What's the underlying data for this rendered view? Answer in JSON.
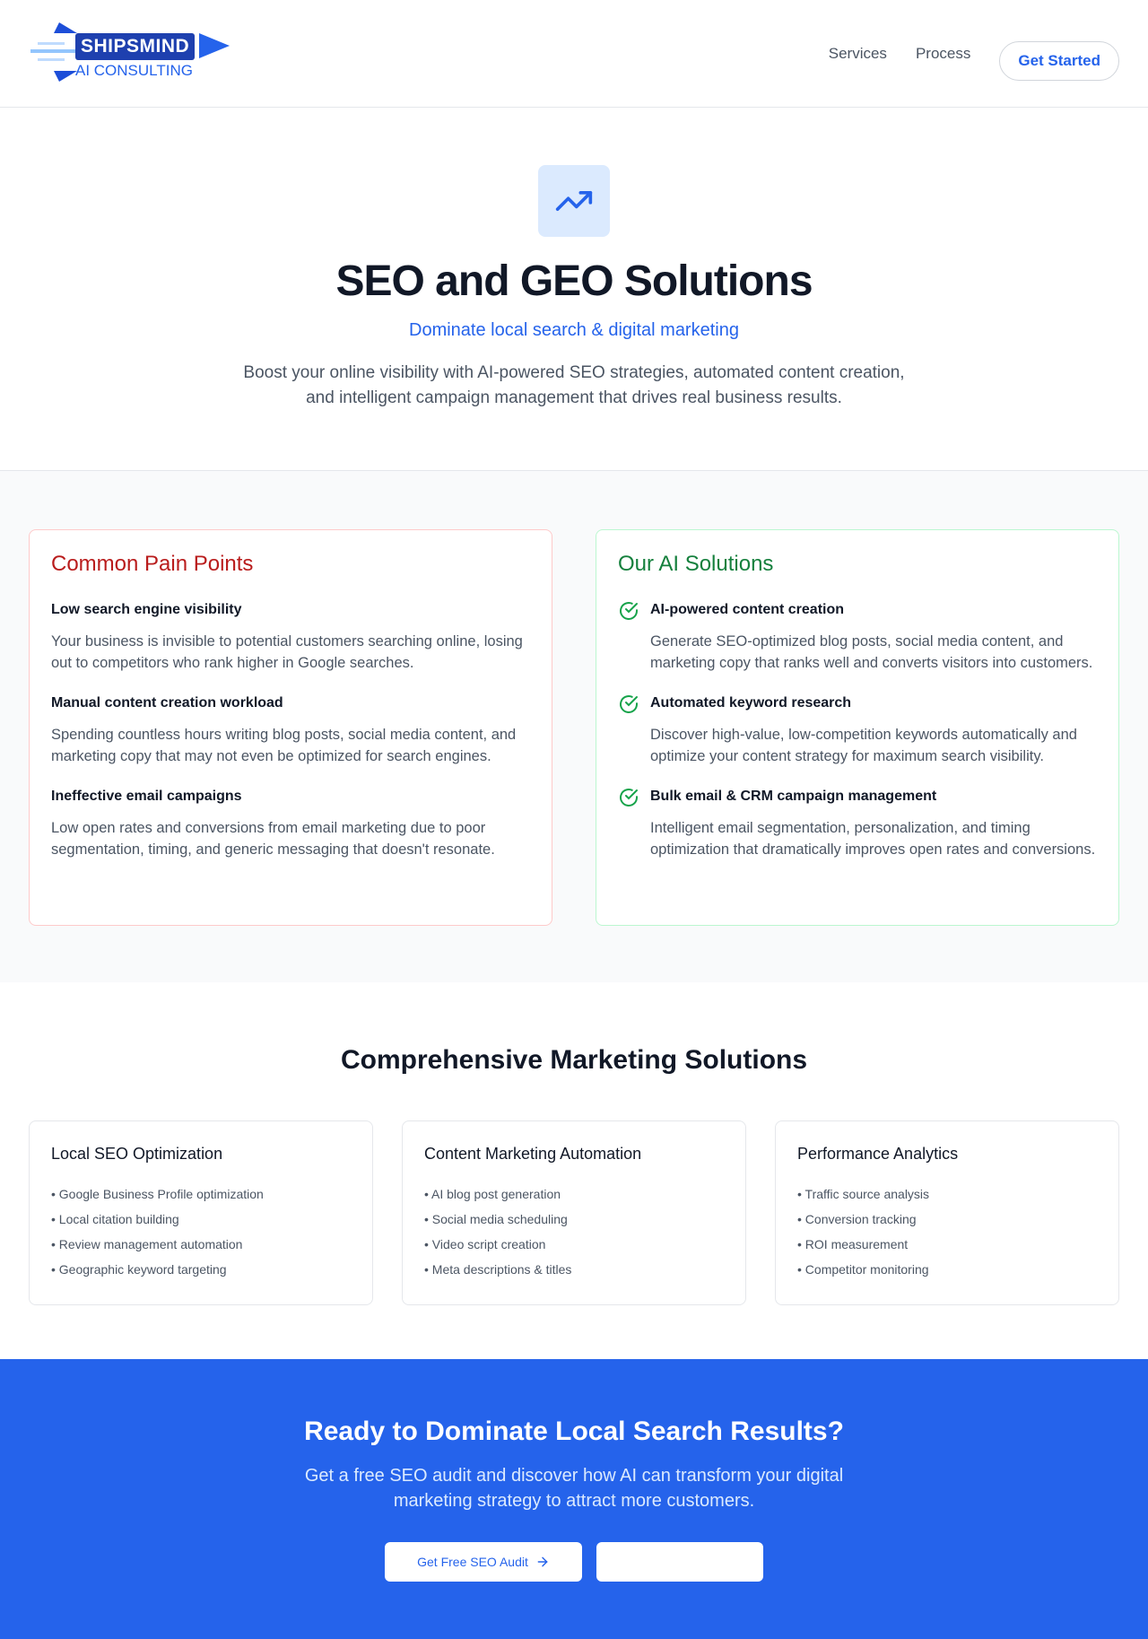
{
  "header": {
    "logo_text": "SHIPSMIND",
    "logo_sub": "AI CONSULTING",
    "nav": [
      "Services",
      "Process"
    ],
    "cta": "Get Started"
  },
  "hero": {
    "icon": "trending-up-icon",
    "title": "SEO and GEO Solutions",
    "tagline": "Dominate local search & digital marketing",
    "description": "Boost your online visibility with AI-powered SEO strategies, automated content creation, and intelligent campaign management that drives real business results."
  },
  "pain": {
    "title": "Common Pain Points",
    "items": [
      {
        "title": "Low search engine visibility",
        "text": "Your business is invisible to potential customers searching online, losing out to competitors who rank higher in Google searches."
      },
      {
        "title": "Manual content creation workload",
        "text": "Spending countless hours writing blog posts, social media content, and marketing copy that may not even be optimized for search engines."
      },
      {
        "title": "Ineffective email campaigns",
        "text": "Low open rates and conversions from email marketing due to poor segmentation, timing, and generic messaging that doesn't resonate."
      }
    ]
  },
  "solutions": {
    "title": "Our AI Solutions",
    "items": [
      {
        "title": "AI-powered content creation",
        "text": "Generate SEO-optimized blog posts, social media content, and marketing copy that ranks well and converts visitors into customers."
      },
      {
        "title": "Automated keyword research",
        "text": "Discover high-value, low-competition keywords automatically and optimize your content strategy for maximum search visibility."
      },
      {
        "title": "Bulk email & CRM campaign management",
        "text": "Intelligent email segmentation, personalization, and timing optimization that dramatically improves open rates and conversions."
      }
    ]
  },
  "marketing": {
    "title": "Comprehensive Marketing Solutions",
    "cards": [
      {
        "title": "Local SEO Optimization",
        "items": [
          "Google Business Profile optimization",
          "Local citation building",
          "Review management automation",
          "Geographic keyword targeting"
        ]
      },
      {
        "title": "Content Marketing Automation",
        "items": [
          "AI blog post generation",
          "Social media scheduling",
          "Video script creation",
          "Meta descriptions & titles"
        ]
      },
      {
        "title": "Performance Analytics",
        "items": [
          "Traffic source analysis",
          "Conversion tracking",
          "ROI measurement",
          "Competitor monitoring"
        ]
      }
    ]
  },
  "cta": {
    "title": "Ready to Dominate Local Search Results?",
    "text": "Get a free SEO audit and discover how AI can transform your digital marketing strategy to attract more customers.",
    "primary": "Get Free SEO Audit"
  },
  "colors": {
    "accent": "#2563eb",
    "pain": "#b91c1c",
    "solution": "#15803d"
  }
}
